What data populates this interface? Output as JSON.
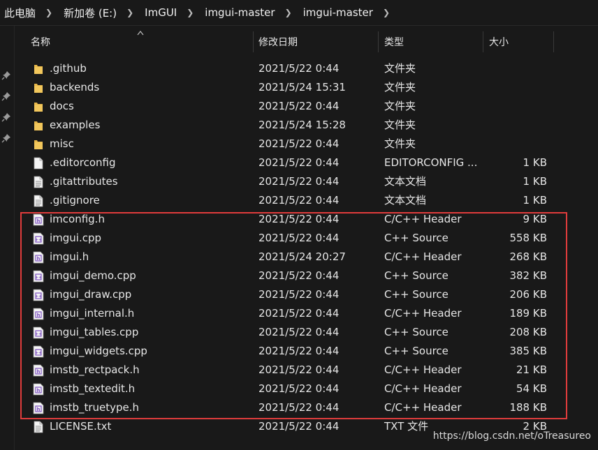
{
  "breadcrumb": [
    "此电脑",
    "新加卷 (E:)",
    "ImGUI",
    "imgui-master",
    "imgui-master"
  ],
  "columns": {
    "name": "名称",
    "date": "修改日期",
    "type": "类型",
    "size": "大小"
  },
  "files": [
    {
      "name": ".github",
      "date": "2021/5/22 0:44",
      "type": "文件夹",
      "size": "",
      "icon": "folder-icon"
    },
    {
      "name": "backends",
      "date": "2021/5/24 15:31",
      "type": "文件夹",
      "size": "",
      "icon": "folder-icon"
    },
    {
      "name": "docs",
      "date": "2021/5/22 0:44",
      "type": "文件夹",
      "size": "",
      "icon": "folder-icon"
    },
    {
      "name": "examples",
      "date": "2021/5/24 15:28",
      "type": "文件夹",
      "size": "",
      "icon": "folder-icon"
    },
    {
      "name": "misc",
      "date": "2021/5/22 0:44",
      "type": "文件夹",
      "size": "",
      "icon": "folder-icon"
    },
    {
      "name": ".editorconfig",
      "date": "2021/5/22 0:44",
      "type": "EDITORCONFIG ...",
      "size": "1 KB",
      "icon": "blank-file-icon"
    },
    {
      "name": ".gitattributes",
      "date": "2021/5/22 0:44",
      "type": "文本文档",
      "size": "1 KB",
      "icon": "text-file-icon"
    },
    {
      "name": ".gitignore",
      "date": "2021/5/22 0:44",
      "type": "文本文档",
      "size": "1 KB",
      "icon": "text-file-icon"
    },
    {
      "name": "imconfig.h",
      "date": "2021/5/22 0:44",
      "type": "C/C++ Header",
      "size": "9 KB",
      "icon": "header-file-icon"
    },
    {
      "name": "imgui.cpp",
      "date": "2021/5/22 0:44",
      "type": "C++ Source",
      "size": "558 KB",
      "icon": "source-file-icon"
    },
    {
      "name": "imgui.h",
      "date": "2021/5/24 20:27",
      "type": "C/C++ Header",
      "size": "268 KB",
      "icon": "header-file-icon"
    },
    {
      "name": "imgui_demo.cpp",
      "date": "2021/5/22 0:44",
      "type": "C++ Source",
      "size": "382 KB",
      "icon": "source-file-icon"
    },
    {
      "name": "imgui_draw.cpp",
      "date": "2021/5/22 0:44",
      "type": "C++ Source",
      "size": "206 KB",
      "icon": "source-file-icon"
    },
    {
      "name": "imgui_internal.h",
      "date": "2021/5/22 0:44",
      "type": "C/C++ Header",
      "size": "189 KB",
      "icon": "header-file-icon"
    },
    {
      "name": "imgui_tables.cpp",
      "date": "2021/5/22 0:44",
      "type": "C++ Source",
      "size": "208 KB",
      "icon": "source-file-icon"
    },
    {
      "name": "imgui_widgets.cpp",
      "date": "2021/5/22 0:44",
      "type": "C++ Source",
      "size": "385 KB",
      "icon": "source-file-icon"
    },
    {
      "name": "imstb_rectpack.h",
      "date": "2021/5/22 0:44",
      "type": "C/C++ Header",
      "size": "21 KB",
      "icon": "header-file-icon"
    },
    {
      "name": "imstb_textedit.h",
      "date": "2021/5/22 0:44",
      "type": "C/C++ Header",
      "size": "54 KB",
      "icon": "header-file-icon"
    },
    {
      "name": "imstb_truetype.h",
      "date": "2021/5/22 0:44",
      "type": "C/C++ Header",
      "size": "188 KB",
      "icon": "header-file-icon"
    },
    {
      "name": "LICENSE.txt",
      "date": "2021/5/22 0:44",
      "type": "TXT 文件",
      "size": "2 KB",
      "icon": "text-file-icon"
    }
  ],
  "watermark": "https://blog.csdn.net/oTreasureo",
  "colors": {
    "background": "#191919",
    "text": "#e6e6e6",
    "folder": "#e8b84a",
    "highlight": "#e03c3c"
  }
}
